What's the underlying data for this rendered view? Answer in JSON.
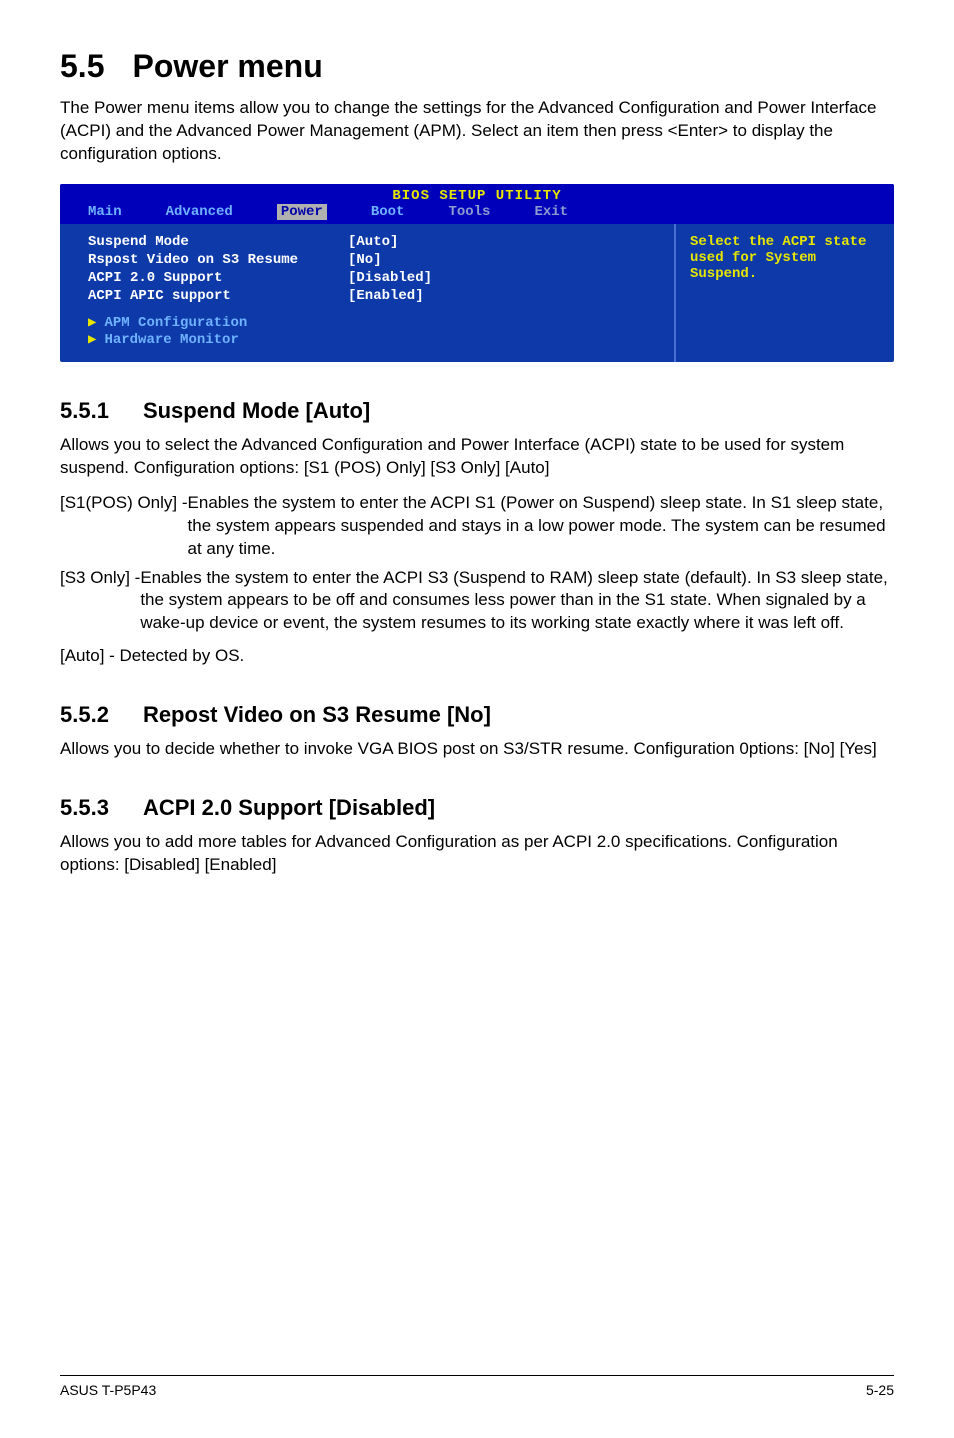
{
  "section": {
    "num": "5.5",
    "title": "Power menu"
  },
  "intro": "The Power menu items allow you to change the settings for the Advanced Configuration and Power Interface (ACPI) and the Advanced Power Management (APM). Select an item then press <Enter> to display the configuration options.",
  "bios": {
    "title": "BIOS SETUP UTILITY",
    "tabs": [
      "Main",
      "Advanced",
      "Power",
      "Boot",
      "Tools",
      "Exit"
    ],
    "active_tab": "Power",
    "rows": [
      {
        "label": "Suspend Mode",
        "value": "[Auto]"
      },
      {
        "label": "Rspost Video on S3 Resume",
        "value": "[No]"
      },
      {
        "label": "ACPI 2.0 Support",
        "value": "[Disabled]"
      },
      {
        "label": "ACPI APIC support",
        "value": "[Enabled]"
      }
    ],
    "subs": [
      "APM Configuration",
      "Hardware Monitor"
    ],
    "help": "Select the ACPI state used for System Suspend."
  },
  "s1": {
    "num": "5.5.1",
    "title": "Suspend Mode [Auto]",
    "para": "Allows you to select the Advanced Configuration and Power Interface (ACPI) state to be used for system suspend. Configuration options: [S1 (POS) Only] [S3 Only] [Auto]",
    "d1_term": "[S1(POS) Only] - ",
    "d1_desc": "Enables the system to enter the ACPI S1 (Power on Suspend) sleep state. In S1 sleep state, the system appears suspended and stays in a low power mode. The system can be resumed at any time.",
    "d2_term": "[S3 Only] - ",
    "d2_desc": "Enables the system to enter the ACPI S3 (Suspend to RAM) sleep state (default). In S3 sleep state, the system appears to be off and consumes less power than in the S1 state. When signaled by a wake-up device or event, the system resumes to its working state exactly where it was left off.",
    "d3": "[Auto] - Detected by OS."
  },
  "s2": {
    "num": "5.5.2",
    "title": "Repost Video on S3 Resume [No]",
    "para": "Allows you to decide whether to invoke VGA BIOS post on S3/STR resume. Configuration 0ptions: [No] [Yes]"
  },
  "s3": {
    "num": "5.5.3",
    "title": "ACPI 2.0 Support [Disabled]",
    "para": "Allows you to add more tables for Advanced Configuration as per ACPI 2.0 specifications. Configuration options: [Disabled] [Enabled]"
  },
  "footer": {
    "left": "ASUS T-P5P43",
    "right": "5-25"
  }
}
